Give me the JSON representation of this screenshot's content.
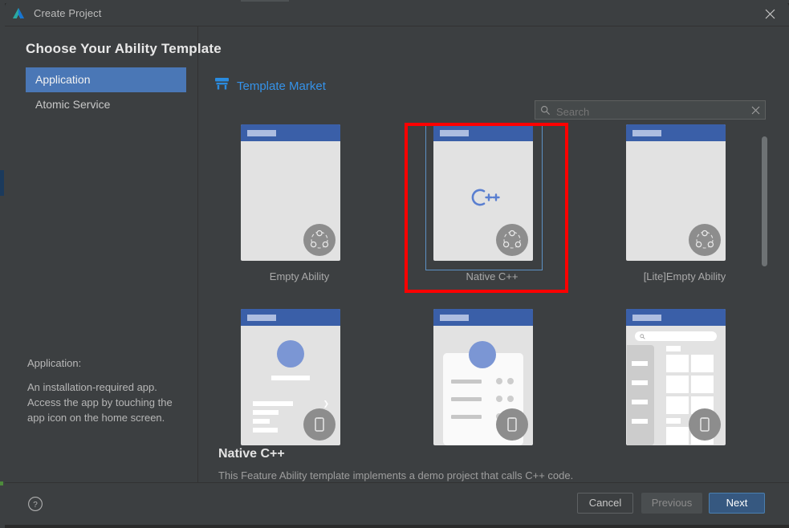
{
  "window": {
    "title": "Create Project",
    "logo_icon": "deveco-studio-logo",
    "close_icon": "close-icon"
  },
  "heading": "Choose Your Ability Template",
  "categories": {
    "items": [
      {
        "label": "Application",
        "selected": true
      },
      {
        "label": "Atomic Service",
        "selected": false
      }
    ]
  },
  "side_info": {
    "title": "Application:",
    "body": "An installation-required app. Access the app by touching the app icon on the home screen."
  },
  "market": {
    "icon": "template-market-store-icon",
    "label": "Template Market",
    "color": "#3592e8"
  },
  "search": {
    "icon": "search-icon",
    "placeholder": "Search",
    "value": "",
    "clear_icon": "close-icon"
  },
  "templates": [
    {
      "label": "Empty Ability",
      "kind": "plain",
      "selected": false,
      "badge": "harmony-share-icon"
    },
    {
      "label": "Native C++",
      "kind": "cpp",
      "selected": true,
      "badge": "harmony-share-icon",
      "logo_text": "C++"
    },
    {
      "label": "[Lite]Empty Ability",
      "kind": "plain",
      "selected": false,
      "badge": "harmony-share-icon"
    },
    {
      "label": "",
      "kind": "profile",
      "selected": false,
      "badge": "phone-device-icon"
    },
    {
      "label": "",
      "kind": "card",
      "selected": false,
      "badge": "phone-device-icon"
    },
    {
      "label": "",
      "kind": "grid",
      "selected": false,
      "badge": "phone-device-icon"
    }
  ],
  "annotation": {
    "shape": "rectangle",
    "color": "#fe0000",
    "target": "Native C++"
  },
  "scrollbar": {
    "orientation": "vertical"
  },
  "description": {
    "title": "Native C++",
    "body": "This Feature Ability template implements a demo project that calls C++ code."
  },
  "footer": {
    "help_icon": "help-circle-icon",
    "cancel_label": "Cancel",
    "previous_label": "Previous",
    "next_label": "Next",
    "next_color": "#365880"
  }
}
